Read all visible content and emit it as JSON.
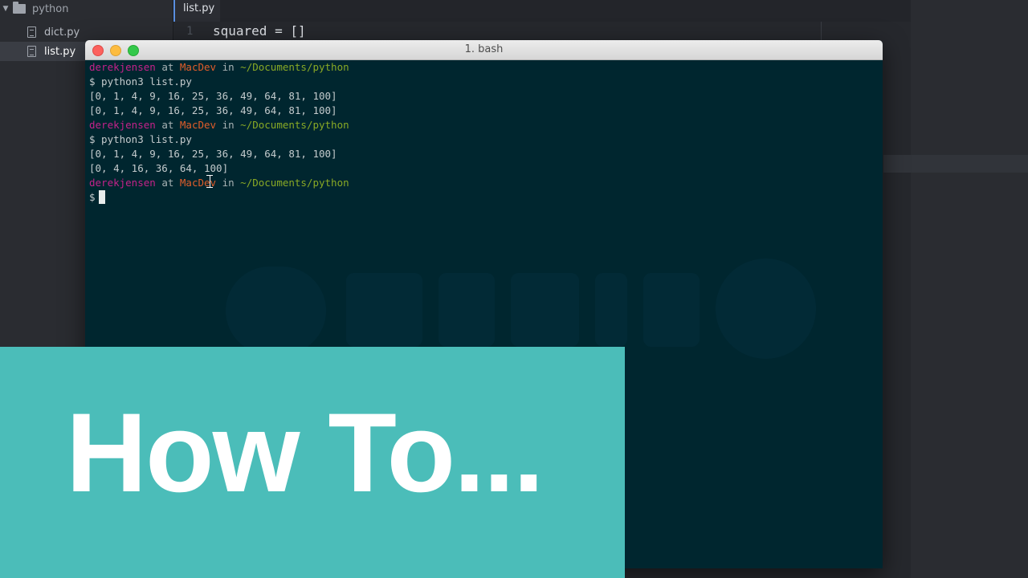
{
  "sidebar": {
    "folder_name": "python",
    "files": [
      {
        "name": "dict.py",
        "selected": false
      },
      {
        "name": "list.py",
        "selected": true
      }
    ]
  },
  "editor": {
    "active_tab": "list.py",
    "line_number": "1",
    "code_line": "squared = []"
  },
  "terminal": {
    "title": "1. bash",
    "prompt_user": "derekjensen",
    "prompt_at": " at ",
    "prompt_host": "MacDev",
    "prompt_in": " in ",
    "prompt_path": "~/Documents/python",
    "command": "$ python3 list.py",
    "output": {
      "run1_line1": "[0, 1, 4, 9, 16, 25, 36, 49, 64, 81, 100]",
      "run1_line2": "[0, 1, 4, 9, 16, 25, 36, 49, 64, 81, 100]",
      "run2_line1": "[0, 1, 4, 9, 16, 25, 36, 49, 64, 81, 100]",
      "run2_line2": "[0, 4, 16, 36, 64, 100]"
    },
    "dollar": "$"
  },
  "overlay": {
    "title": "How To...",
    "color": "#4bbdb9"
  },
  "colors": {
    "terminal_bg": "#00262f",
    "user": "#c5228a",
    "host": "#e15d2a",
    "path": "#89a925"
  },
  "icons": {
    "folder": "folder-icon",
    "file": "file-icon",
    "chevron": "chevron-down-icon"
  }
}
